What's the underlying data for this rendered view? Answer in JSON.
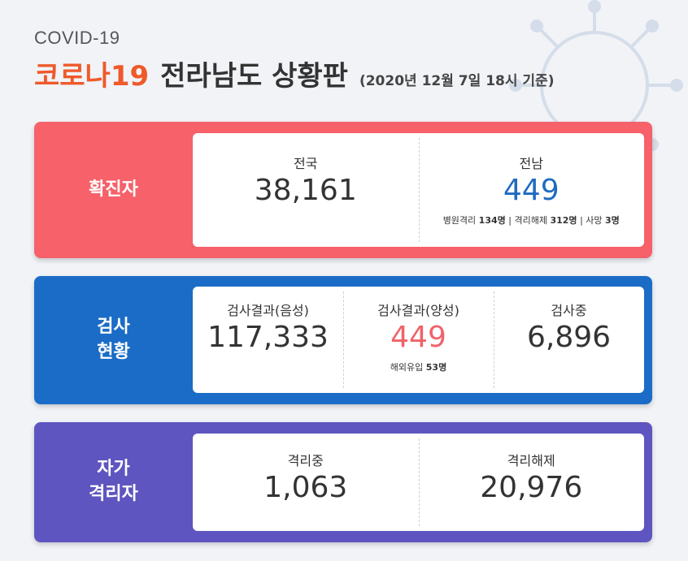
{
  "header": {
    "subtitle": "COVID-19",
    "title_accent": "코로나19",
    "title_main": "전라남도 상황판",
    "timestamp": "(2020년 12월 7일 18시 기준)"
  },
  "confirmed": {
    "label": "확진자",
    "national_label": "전국",
    "national_value": "38,161",
    "jeonnam_label": "전남",
    "jeonnam_value": "449",
    "hospital_label": "병원격리",
    "hospital_value": "134명",
    "sep1": "|",
    "released_label": "격리해제",
    "released_value": "312명",
    "sep2": "|",
    "death_label": "사망",
    "death_value": "3명"
  },
  "testing": {
    "label_line1": "검사",
    "label_line2": "현황",
    "negative_label": "검사결과(음성)",
    "negative_value": "117,333",
    "positive_label": "검사결과(양성)",
    "positive_value": "449",
    "overseas_label": "해외유입",
    "overseas_value": "53명",
    "pending_label": "검사중",
    "pending_value": "6,896"
  },
  "quarantine": {
    "label_line1": "자가",
    "label_line2": "격리자",
    "in_label": "격리중",
    "in_value": "1,063",
    "released_label": "격리해제",
    "released_value": "20,976"
  },
  "colors": {
    "accent": "#ef5a2b",
    "confirmed_panel": "#f6616a",
    "testing_panel": "#1b6cc6",
    "quarantine_panel": "#5e55c0",
    "jeonnam_value": "#1f6bc0",
    "positive_value": "#f0636a"
  },
  "icons": {
    "background": "virus-icon"
  }
}
